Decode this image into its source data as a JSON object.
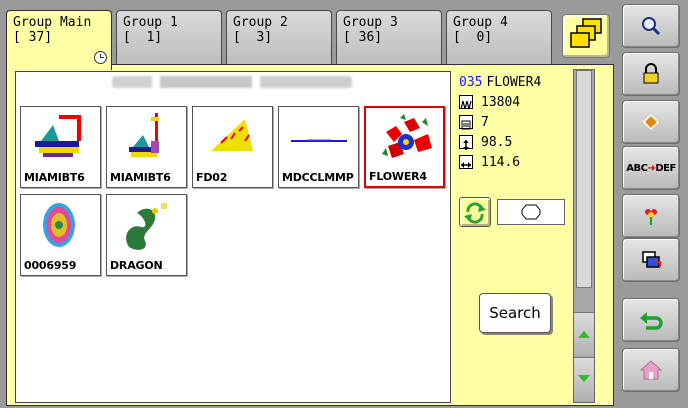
{
  "tabs": [
    {
      "name": "Group Main",
      "count": "[ 37]",
      "active": true
    },
    {
      "name": "Group 1",
      "count": "[  1]",
      "active": false
    },
    {
      "name": "Group 2",
      "count": "[  3]",
      "active": false
    },
    {
      "name": "Group 3",
      "count": "[ 36]",
      "active": false
    },
    {
      "name": "Group 4",
      "count": "[  0]",
      "active": false
    }
  ],
  "designs": [
    {
      "label": "MIAMIBT6"
    },
    {
      "label": "MIAMIBT6"
    },
    {
      "label": "FD02"
    },
    {
      "label": "MDCCLMMP"
    },
    {
      "label": "FLOWER4",
      "selected": true
    },
    {
      "label": "0006959"
    },
    {
      "label": "DRAGON"
    }
  ],
  "info": {
    "number": "035",
    "name": "FLOWER4",
    "stitches": "13804",
    "colors": "7",
    "height": "98.5",
    "width": "114.6"
  },
  "search_label": "Search",
  "toolbar": {
    "abc_text": "ABC",
    "def_text": "DEF"
  },
  "colors": {
    "panel_yellow": "#ffffa6",
    "selected_border": "#e00000",
    "scroll_arrow": "#2fb82f",
    "home_icon": "#e8a0c8"
  }
}
